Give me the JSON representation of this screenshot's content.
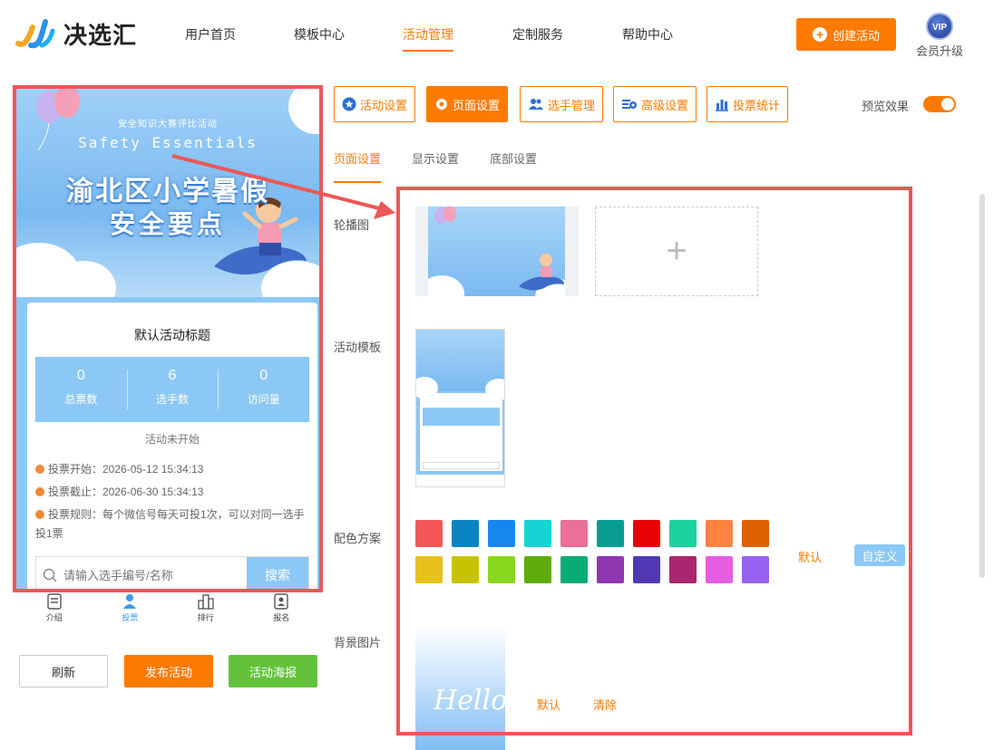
{
  "header": {
    "logo_text": "决选汇",
    "nav": [
      "用户首页",
      "模板中心",
      "活动管理",
      "定制服务",
      "帮助中心"
    ],
    "create_label": "创建活动",
    "vip_badge": "VIP",
    "vip_label": "会员升级"
  },
  "preview": {
    "banner": {
      "subtitle": "安全知识大赛评比活动",
      "english": "Safety  Essentials",
      "title_line1": "渝北区小学暑假",
      "title_line2": "安全要点"
    },
    "card_title": "默认活动标题",
    "stats": [
      {
        "value": "0",
        "label": "总票数"
      },
      {
        "value": "6",
        "label": "选手数"
      },
      {
        "value": "0",
        "label": "访问量"
      }
    ],
    "status": "活动未开始",
    "vote_start": "投票开始：2026-05-12 15:34:13",
    "vote_end": "投票截止：2026-06-30 15:34:13",
    "vote_rule": "投票规则：每个微信号每天可投1次，可以对同一选手投1票",
    "search_placeholder": "请输入选手编号/名称",
    "search_button": "搜索",
    "tabs": [
      "介绍",
      "投票",
      "排行",
      "报名"
    ]
  },
  "actions": {
    "refresh": "刷新",
    "publish": "发布活动",
    "poster": "活动海报"
  },
  "settings": {
    "tabs": [
      "活动设置",
      "页面设置",
      "选手管理",
      "高级设置",
      "投票统计"
    ],
    "preview_label": "预览效果",
    "subtabs": [
      "页面设置",
      "显示设置",
      "底部设置"
    ],
    "labels": {
      "carousel": "轮播图",
      "template": "活动模板",
      "scheme": "配色方案",
      "background": "背景图片"
    },
    "scheme_default": "默认",
    "scheme_custom": "自定义",
    "bg_default": "默认",
    "bg_clear": "清除",
    "bg_hello": "Hello",
    "colors": [
      "#f25656",
      "#0a85c2",
      "#1787f0",
      "#14d5d3",
      "#e8709a",
      "#079e91",
      "#e80404",
      "#1bd39e",
      "#fd8340",
      "#dd6100",
      "#e8c21a",
      "#c7c300",
      "#89d61e",
      "#5fac0b",
      "#0aac76",
      "#8e35b0",
      "#5039b3",
      "#a8276f",
      "#e55de0",
      "#9763f0"
    ]
  }
}
